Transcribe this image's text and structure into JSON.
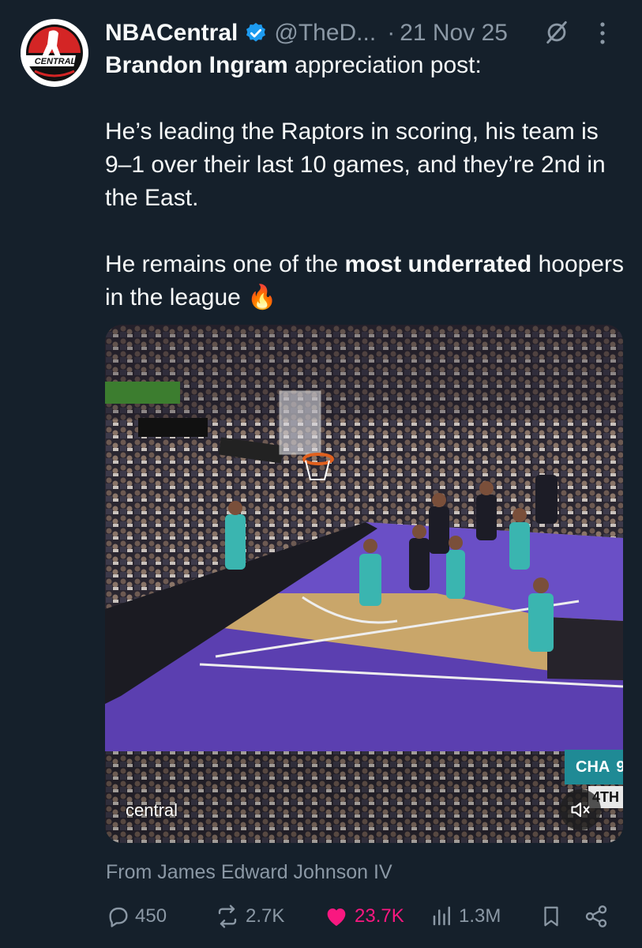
{
  "post": {
    "author_name": "NBACentral",
    "handle": "@TheD...",
    "separator": "·",
    "date": "21 Nov 25",
    "avatar_text": "CENTRAL",
    "body": {
      "p1_bold": "Brandon Ingram",
      "p1_rest": " appreciation post:",
      "p2": "He’s leading the Raptors in scoring, his team is 9–1 over their last 10 games, and they’re 2nd in the East.",
      "p3_start": "He remains one of the ",
      "p3_bold": "most underrated",
      "p3_end": " hoopers in the league ",
      "emoji": "🔥"
    },
    "media": {
      "watermark": "central",
      "score_team": "CHA",
      "score_digit": "9",
      "quarter": "4TH",
      "mute_icon": "speaker-muted-icon"
    },
    "source": "From James Edward Johnson IV",
    "actions": {
      "replies": "450",
      "reposts": "2.7K",
      "likes": "23.7K",
      "views": "1.3M"
    },
    "colors": {
      "background": "#15202b",
      "text": "#f7f9f9",
      "muted": "#8b98a5",
      "verified": "#1d9bf0",
      "like": "#f91880",
      "court_purple": "#5b3fb0"
    }
  }
}
